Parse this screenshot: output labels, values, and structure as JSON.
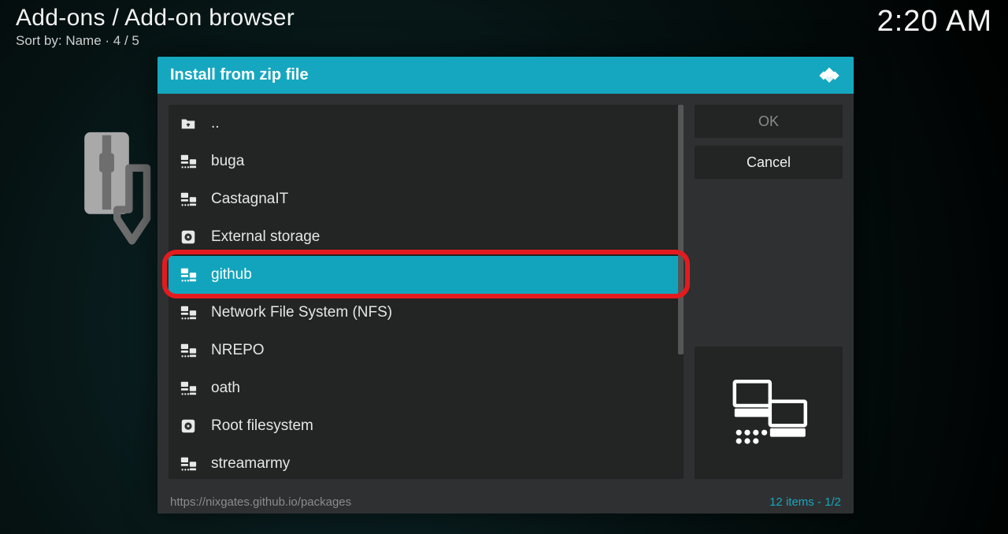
{
  "header": {
    "breadcrumb": "Add-ons / Add-on browser",
    "sort_prefix": "Sort by: ",
    "sort_value": "Name",
    "sort_sep": "  ·  ",
    "position": "4 / 5",
    "clock": "2:20 AM"
  },
  "dialog": {
    "title": "Install from zip file",
    "files": [
      {
        "label": "..",
        "icon": "folder-up",
        "selected": false
      },
      {
        "label": "buga",
        "icon": "net-share",
        "selected": false
      },
      {
        "label": "CastagnaIT",
        "icon": "net-share",
        "selected": false
      },
      {
        "label": "External storage",
        "icon": "disk",
        "selected": false
      },
      {
        "label": "github",
        "icon": "net-share",
        "selected": true
      },
      {
        "label": "Network File System (NFS)",
        "icon": "net-share",
        "selected": false
      },
      {
        "label": "NREPO",
        "icon": "net-share",
        "selected": false
      },
      {
        "label": "oath",
        "icon": "net-share",
        "selected": false
      },
      {
        "label": "Root filesystem",
        "icon": "disk",
        "selected": false
      },
      {
        "label": "streamarmy",
        "icon": "net-share",
        "selected": false
      }
    ],
    "buttons": {
      "ok": "OK",
      "cancel": "Cancel"
    },
    "footer": {
      "path": "https://nixgates.github.io/packages",
      "count_items": "12 items",
      "count_sep": " - ",
      "page": "1/2"
    }
  },
  "highlight_index": 4
}
